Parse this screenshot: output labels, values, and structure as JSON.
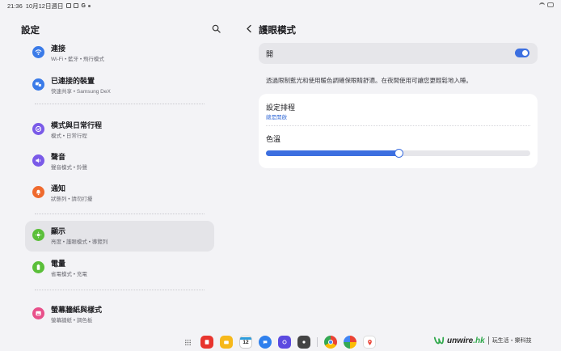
{
  "status_bar": {
    "time": "21:36",
    "date": "10月12日週日"
  },
  "left_panel": {
    "title": "設定",
    "items": [
      {
        "title": "連接",
        "subtitle": "Wi-Fi • 藍牙 • 飛行模式",
        "icon": "wifi-icon",
        "color": "#3b7be8"
      },
      {
        "title": "已連接的裝置",
        "subtitle": "快速共享 • Samsung DeX",
        "icon": "devices-icon",
        "color": "#3b7be8"
      },
      {
        "title": "模式與日常行程",
        "subtitle": "模式 • 日常行程",
        "icon": "modes-icon",
        "color": "#7a5ae8"
      },
      {
        "title": "聲音",
        "subtitle": "聲音模式 • 鈴聲",
        "icon": "sound-icon",
        "color": "#7a5ae8"
      },
      {
        "title": "通知",
        "subtitle": "狀態列 • 請勿打擾",
        "icon": "bell-icon",
        "color": "#ef6a2e"
      },
      {
        "title": "顯示",
        "subtitle": "亮度 • 護眼模式 • 導覽列",
        "icon": "display-icon",
        "color": "#5bbf3a"
      },
      {
        "title": "電量",
        "subtitle": "省電模式 • 充電",
        "icon": "battery-icon",
        "color": "#5bbf3a"
      },
      {
        "title": "螢幕牆紙與樣式",
        "subtitle": "螢幕牆紙 • 調色板",
        "icon": "wallpaper-icon",
        "color": "#e8508a"
      }
    ]
  },
  "right_panel": {
    "title": "護眼模式",
    "toggle": {
      "label": "開",
      "on": true
    },
    "description": "透過限制藍光和使用暖色調確保眼睛舒適。在夜間使用可讓您更輕鬆地入睡。",
    "schedule": {
      "title": "設定排程",
      "value": "總是開啟"
    },
    "color_temp": {
      "title": "色溫",
      "level": 0.5
    }
  },
  "watermark": {
    "brand_main": "unwire",
    "brand_suffix": ".hk",
    "tagline": "玩生活・樂科技"
  },
  "taskbar": {
    "calendar_day": "12"
  },
  "colors": {
    "accent": "#3c6fe0",
    "background": "#f3f3f6"
  }
}
